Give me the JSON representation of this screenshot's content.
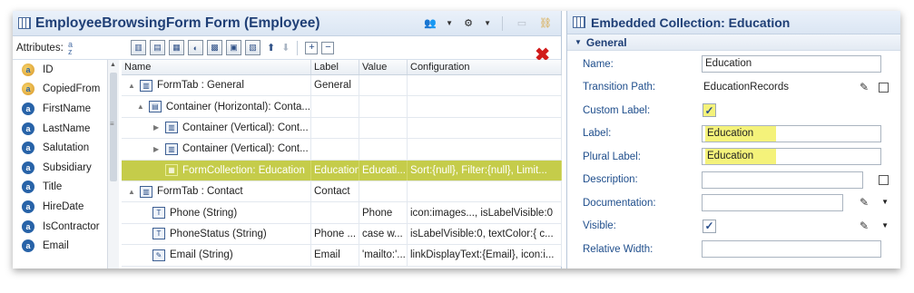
{
  "left": {
    "title": "EmployeeBrowsingForm Form (Employee)",
    "attributes_label": "Attributes:",
    "attributes": [
      {
        "icon": "key-icon",
        "name": "ID"
      },
      {
        "icon": "key-icon",
        "name": "CopiedFrom"
      },
      {
        "icon": "attribute-icon",
        "name": "FirstName"
      },
      {
        "icon": "attribute-icon",
        "name": "LastName"
      },
      {
        "icon": "attribute-icon",
        "name": "Salutation"
      },
      {
        "icon": "attribute-icon",
        "name": "Subsidiary"
      },
      {
        "icon": "attribute-icon",
        "name": "Title"
      },
      {
        "icon": "attribute-icon",
        "name": "HireDate"
      },
      {
        "icon": "attribute-icon",
        "name": "IsContractor"
      },
      {
        "icon": "attribute-icon",
        "name": "Email"
      }
    ],
    "columns": [
      "Name",
      "Label",
      "Value",
      "Configuration"
    ],
    "rows": [
      {
        "indent": 0,
        "twisty": "▲",
        "icon": "tab-icon",
        "name": "FormTab : General",
        "label": "General",
        "value": "",
        "conf": ""
      },
      {
        "indent": 1,
        "twisty": "▲",
        "icon": "container-icon",
        "name": "Container (Horizontal): Conta...",
        "label": "",
        "value": "",
        "conf": ""
      },
      {
        "indent": 2,
        "twisty": "▶",
        "icon": "container-icon",
        "name": "Container (Vertical): Cont...",
        "label": "",
        "value": "",
        "conf": ""
      },
      {
        "indent": 2,
        "twisty": "▶",
        "icon": "container-icon",
        "name": "Container (Vertical): Cont...",
        "label": "",
        "value": "",
        "conf": ""
      },
      {
        "indent": 2,
        "twisty": "",
        "icon": "collection-icon",
        "name": "FormCollection: Education",
        "label": "Education",
        "value": "Educati...",
        "conf": "Sort:{null}, Filter:{null}, Limit...",
        "selected": true
      },
      {
        "indent": 0,
        "twisty": "▲",
        "icon": "tab-icon",
        "name": "FormTab : Contact",
        "label": "Contact",
        "value": "",
        "conf": ""
      },
      {
        "indent": 1,
        "twisty": "",
        "icon": "text-icon",
        "name": "Phone (String)",
        "label": "",
        "value": "Phone",
        "conf": "icon:images..., isLabelVisible:0"
      },
      {
        "indent": 1,
        "twisty": "",
        "icon": "text-icon",
        "name": "PhoneStatus (String)",
        "label": "Phone ...",
        "value": "case  w...",
        "conf": "isLabelVisible:0, textColor:{  c..."
      },
      {
        "indent": 1,
        "twisty": "",
        "icon": "edit-icon",
        "name": "Email (String)",
        "label": "Email",
        "value": "'mailto:'...",
        "conf": "linkDisplayText:{Email}, icon:i..."
      }
    ]
  },
  "right": {
    "title": "Embedded Collection: Education",
    "section": "General",
    "fields": {
      "name_label": "Name:",
      "name_value": "Education",
      "transition_label": "Transition Path:",
      "transition_value": "EducationRecords",
      "custom_label_label": "Custom Label:",
      "custom_label_checked": "✓",
      "label_label": "Label:",
      "label_value": "Education",
      "plural_label": "Plural Label:",
      "plural_value": "Education",
      "description_label": "Description:",
      "description_value": "",
      "documentation_label": "Documentation:",
      "documentation_value": "",
      "visible_label": "Visible:",
      "visible_checked": "✓",
      "relative_width_label": "Relative Width:",
      "relative_width_value": ""
    }
  },
  "colors": {
    "selected_row": "#c5cc4a",
    "highlight": "#f4f27a",
    "title_blue": "#1f3f76"
  }
}
